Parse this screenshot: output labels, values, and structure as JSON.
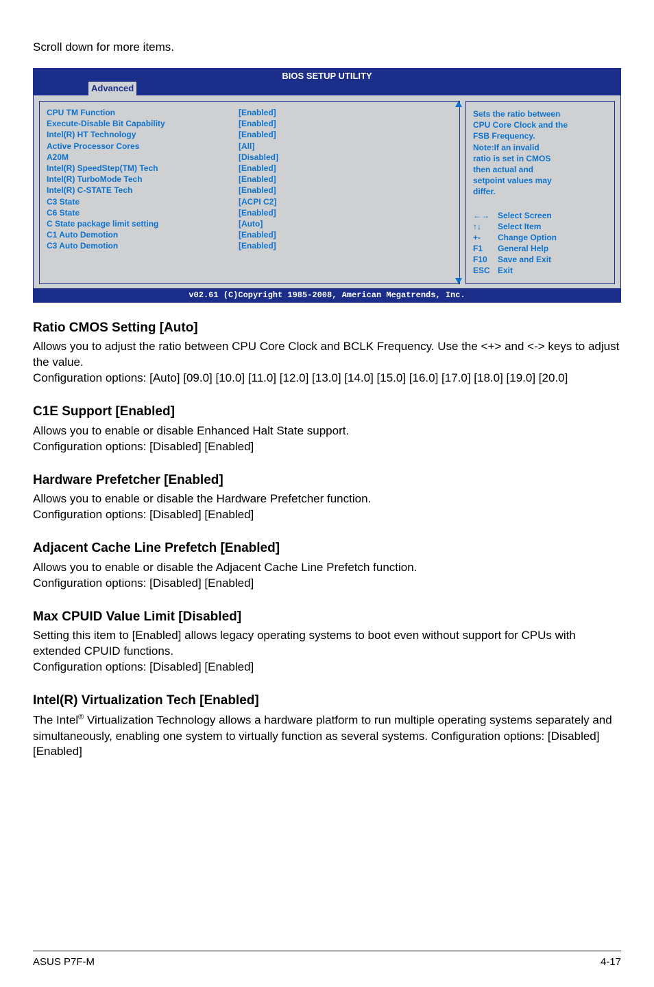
{
  "top_note": "Scroll down for more items.",
  "bios": {
    "title": "BIOS SETUP UTILITY",
    "tab_active": "Advanced",
    "rows": [
      {
        "name": "CPU TM Function",
        "val": "[Enabled]"
      },
      {
        "name": "Execute-Disable Bit Capability",
        "val": "[Enabled]"
      },
      {
        "name": "Intel(R) HT Technology",
        "val": "[Enabled]"
      },
      {
        "name": "Active Processor Cores",
        "val": "[All]"
      },
      {
        "name": "A20M",
        "val": "[Disabled]"
      },
      {
        "name": "Intel(R) SpeedStep(TM) Tech",
        "val": "[Enabled]"
      },
      {
        "name": "Intel(R) TurboMode Tech",
        "val": "[Enabled]"
      },
      {
        "name": "Intel(R) C-STATE Tech",
        "val": "[Enabled]"
      },
      {
        "name": "C3 State",
        "val": "[ACPI C2]"
      },
      {
        "name": "C6 State",
        "val": "[Enabled]"
      },
      {
        "name": "C State package limit setting",
        "val": "[Auto]"
      },
      {
        "name": "C1 Auto Demotion",
        "val": "[Enabled]"
      },
      {
        "name": "C3 Auto Demotion",
        "val": "[Enabled]"
      }
    ],
    "help": {
      "l1": "Sets the ratio between",
      "l2": "CPU Core Clock and the",
      "l3": "FSB Frequency.",
      "l4": "Note:If an invalid",
      "l5": "ratio is set in CMOS",
      "l6": "then actual and",
      "l7": "setpoint values may",
      "l8": "differ."
    },
    "legend": [
      {
        "key": "←→",
        "label": "Select Screen"
      },
      {
        "key": "↑↓",
        "label": "Select Item"
      },
      {
        "key": "+-",
        "label": "Change Option"
      },
      {
        "key": "F1",
        "label": "General Help"
      },
      {
        "key": "F10",
        "label": "Save and Exit"
      },
      {
        "key": "ESC",
        "label": "Exit"
      }
    ],
    "footer": "v02.61 (C)Copyright 1985-2008, American Megatrends, Inc."
  },
  "sections": {
    "s1": {
      "title": "Ratio CMOS Setting [Auto]",
      "p1": "Allows you to adjust the ratio between CPU Core Clock and BCLK Frequency. Use the <+> and <-> keys to adjust the value.",
      "p2": "Configuration options: [Auto] [09.0] [10.0] [11.0] [12.0] [13.0] [14.0] [15.0] [16.0] [17.0] [18.0] [19.0] [20.0]"
    },
    "s2": {
      "title": "C1E Support [Enabled]",
      "p1": "Allows you to enable or disable Enhanced Halt State support.",
      "p2": "Configuration options: [Disabled] [Enabled]"
    },
    "s3": {
      "title": "Hardware Prefetcher [Enabled]",
      "p1": "Allows you to enable or disable the Hardware Prefetcher function.",
      "p2": "Configuration options: [Disabled] [Enabled]"
    },
    "s4": {
      "title": "Adjacent Cache Line Prefetch [Enabled]",
      "p1": "Allows you to enable or disable the Adjacent Cache Line Prefetch function.",
      "p2": "Configuration options: [Disabled] [Enabled]"
    },
    "s5": {
      "title": "Max CPUID Value Limit [Disabled]",
      "p1": "Setting this item to [Enabled] allows legacy operating systems to boot even without support for CPUs with extended CPUID functions.",
      "p2": "Configuration options: [Disabled] [Enabled]"
    },
    "s6": {
      "title": "Intel(R) Virtualization Tech [Enabled]",
      "p1a": "The Intel",
      "p1b": " Virtualization Technology allows a hardware platform to run multiple operating systems separately and simultaneously, enabling one system to virtually function as several systems. Configuration options: [Disabled] [Enabled]"
    }
  },
  "footer": {
    "left": "ASUS P7F-M",
    "right": "4-17"
  }
}
